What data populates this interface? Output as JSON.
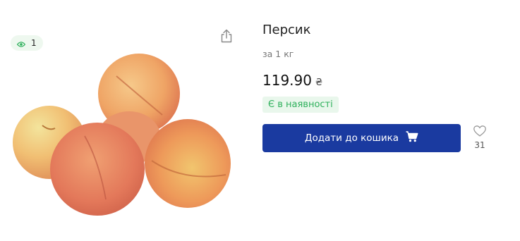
{
  "product": {
    "title": "Персик",
    "unit": "за 1 кг",
    "price": "119.90",
    "currency": "₴",
    "stock_status": "Є в наявності",
    "image_alt": "peaches"
  },
  "views": {
    "count": "1",
    "icon": "eye-icon"
  },
  "actions": {
    "share_icon": "share-icon",
    "add_to_cart_label": "Додати до кошика",
    "cart_icon": "cart-icon",
    "favorite_icon": "heart-icon",
    "favorite_count": "31"
  },
  "colors": {
    "primary": "#1a3aa0",
    "stock_text": "#2fb05c",
    "stock_bg": "#e9f7ec",
    "views_bg": "#eef8ef"
  }
}
